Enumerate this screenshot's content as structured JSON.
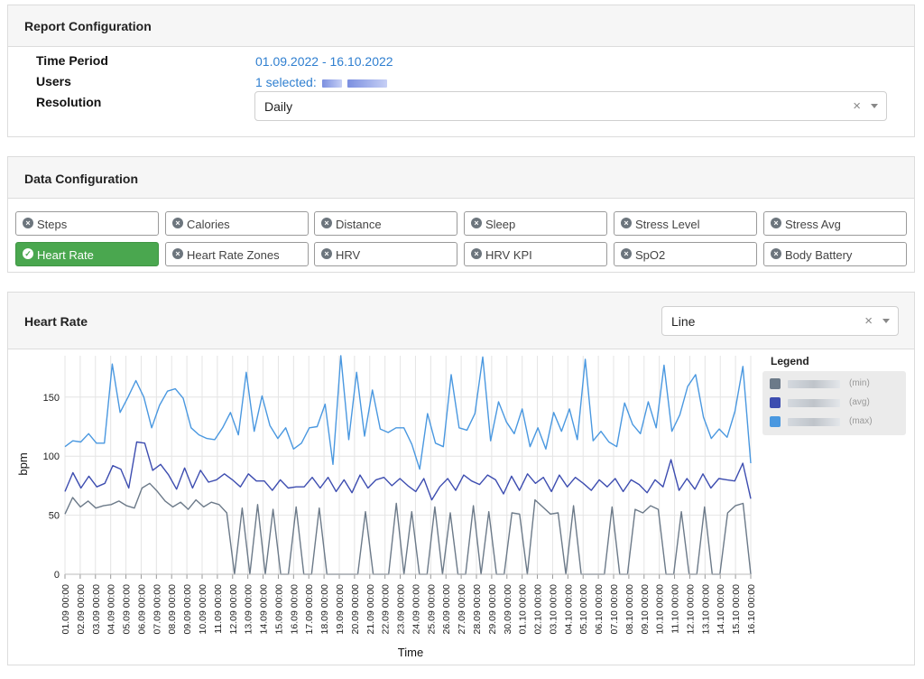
{
  "report": {
    "title": "Report Configuration",
    "time_period_label": "Time Period",
    "time_period_value": "01.09.2022 - 16.10.2022",
    "users_label": "Users",
    "users_value": "1 selected:",
    "resolution_label": "Resolution",
    "resolution_value": "Daily",
    "clear_glyph": "×"
  },
  "data_config": {
    "title": "Data Configuration",
    "chips": [
      {
        "label": "Steps",
        "active": false
      },
      {
        "label": "Calories",
        "active": false
      },
      {
        "label": "Distance",
        "active": false
      },
      {
        "label": "Sleep",
        "active": false
      },
      {
        "label": "Stress Level",
        "active": false
      },
      {
        "label": "Stress Avg",
        "active": false
      },
      {
        "label": "Heart Rate",
        "active": true
      },
      {
        "label": "Heart Rate Zones",
        "active": false
      },
      {
        "label": "HRV",
        "active": false
      },
      {
        "label": "HRV KPI",
        "active": false
      },
      {
        "label": "SpO2",
        "active": false
      },
      {
        "label": "Body Battery",
        "active": false
      }
    ]
  },
  "chart_card": {
    "title": "Heart Rate",
    "type_select_value": "Line",
    "clear_glyph": "×",
    "legend_title": "Legend",
    "legend": [
      {
        "suffix": "(min)",
        "color": "#6c7a89"
      },
      {
        "suffix": "(avg)",
        "color": "#3d4db0"
      },
      {
        "suffix": "(max)",
        "color": "#4a98e0"
      }
    ]
  },
  "chart_data": {
    "type": "line",
    "xlabel": "Time",
    "ylabel": "bpm",
    "ylim": [
      0,
      185
    ],
    "yticks": [
      0,
      50,
      100,
      150
    ],
    "x": [
      "01.09.2022",
      "02.09.2022",
      "03.09.2022",
      "04.09.2022",
      "05.09.2022",
      "06.09.2022",
      "07.09.2022",
      "08.09.2022",
      "09.09.2022",
      "10.09.2022",
      "11.09.2022",
      "12.09.2022",
      "13.09.2022",
      "14.09.2022",
      "15.09.2022",
      "16.09.2022",
      "17.09.2022",
      "18.09.2022",
      "19.09.2022",
      "20.09.2022",
      "21.09.2022",
      "22.09.2022",
      "23.09.2022",
      "24.09.2022",
      "25.09.2022",
      "26.09.2022",
      "27.09.2022",
      "28.09.2022",
      "29.09.2022",
      "30.09.2022",
      "01.10.2022",
      "02.10.2022",
      "03.10.2022",
      "04.10.2022",
      "05.10.2022",
      "06.10.2022",
      "07.10.2022",
      "08.10.2022",
      "09.10.2022",
      "10.10.2022",
      "11.10.2022",
      "12.10.2022",
      "13.10.2022",
      "14.10.2022",
      "15.10.2022",
      "16.10.2022"
    ],
    "xtick_labels": [
      "01.09 00:00",
      "02.09 00:00",
      "03.09 00:00",
      "04.09 00:00",
      "05.09 00:00",
      "06.09 00:00",
      "07.09 00:00",
      "08.09 00:00",
      "09.09 00:00",
      "10.09 00:00",
      "11.09 00:00",
      "12.09 00:00",
      "13.09 00:00",
      "14.09 00:00",
      "15.09 00:00",
      "16.09 00:00",
      "17.09 00:00",
      "18.09 00:00",
      "19.09 00:00",
      "20.09 00:00",
      "21.09 00:00",
      "22.09 00:00",
      "23.09 00:00",
      "24.09 00:00",
      "25.09 00:00",
      "26.09 00:00",
      "27.09 00:00",
      "28.09 00:00",
      "29.09 00:00",
      "30.09 00:00",
      "01.10 00:00",
      "02.10 00:00",
      "03.10 00:00",
      "04.10 00:00",
      "05.10 00:00",
      "06.10 00:00",
      "07.10 00:00",
      "08.10 00:00",
      "09.10 00:00",
      "10.10 00:00",
      "11.10 00:00",
      "12.10 00:00",
      "13.10 00:00",
      "14.10 00:00",
      "15.10 00:00",
      "16.10 00:00"
    ],
    "series": [
      {
        "name": "(max)",
        "color": "#4a98e0",
        "values": [
          108,
          113,
          112,
          119,
          111,
          111,
          178,
          137,
          150,
          164,
          150,
          124,
          143,
          155,
          157,
          149,
          124,
          118,
          115,
          114,
          124,
          137,
          118,
          171,
          121,
          151,
          126,
          115,
          124,
          106,
          111,
          124,
          125,
          144,
          93,
          185,
          114,
          171,
          117,
          156,
          123,
          120,
          124,
          124,
          110,
          89,
          136,
          111,
          108,
          169,
          124,
          122,
          136,
          184,
          113,
          146,
          129,
          119,
          140,
          108,
          124,
          106,
          137,
          121,
          140,
          114,
          182,
          113,
          121,
          112,
          108,
          145,
          127,
          119,
          146,
          124,
          177,
          121,
          135,
          159,
          169,
          133,
          115,
          123,
          116,
          138,
          176,
          94
        ]
      },
      {
        "name": "(avg)",
        "color": "#3d4db0",
        "values": [
          70,
          86,
          73,
          83,
          74,
          77,
          92,
          89,
          73,
          112,
          111,
          88,
          93,
          84,
          72,
          90,
          73,
          88,
          78,
          80,
          85,
          80,
          74,
          85,
          79,
          79,
          71,
          80,
          73,
          74,
          74,
          82,
          73,
          82,
          70,
          80,
          69,
          84,
          73,
          80,
          82,
          75,
          81,
          75,
          70,
          81,
          63,
          74,
          81,
          71,
          84,
          79,
          76,
          84,
          80,
          68,
          83,
          71,
          85,
          77,
          82,
          70,
          84,
          74,
          82,
          77,
          71,
          80,
          74,
          81,
          70,
          80,
          76,
          69,
          80,
          74,
          97,
          71,
          81,
          72,
          85,
          73,
          81,
          80,
          79,
          94,
          64
        ]
      },
      {
        "name": "(min)",
        "color": "#6c7a89",
        "values": [
          51,
          65,
          57,
          62,
          56,
          58,
          59,
          62,
          58,
          56,
          73,
          77,
          70,
          62,
          57,
          61,
          55,
          63,
          57,
          61,
          59,
          52,
          0,
          56,
          0,
          59,
          0,
          55,
          0,
          0,
          57,
          0,
          0,
          56,
          0,
          0,
          0,
          0,
          0,
          53,
          0,
          0,
          0,
          60,
          0,
          53,
          0,
          0,
          57,
          0,
          52,
          0,
          0,
          58,
          0,
          53,
          0,
          0,
          52,
          51,
          0,
          63,
          57,
          51,
          52,
          0,
          58,
          0,
          0,
          0,
          0,
          57,
          0,
          0,
          55,
          52,
          58,
          55,
          0,
          0,
          53,
          0,
          0,
          57,
          0,
          0,
          52,
          58,
          60,
          0
        ]
      }
    ]
  }
}
